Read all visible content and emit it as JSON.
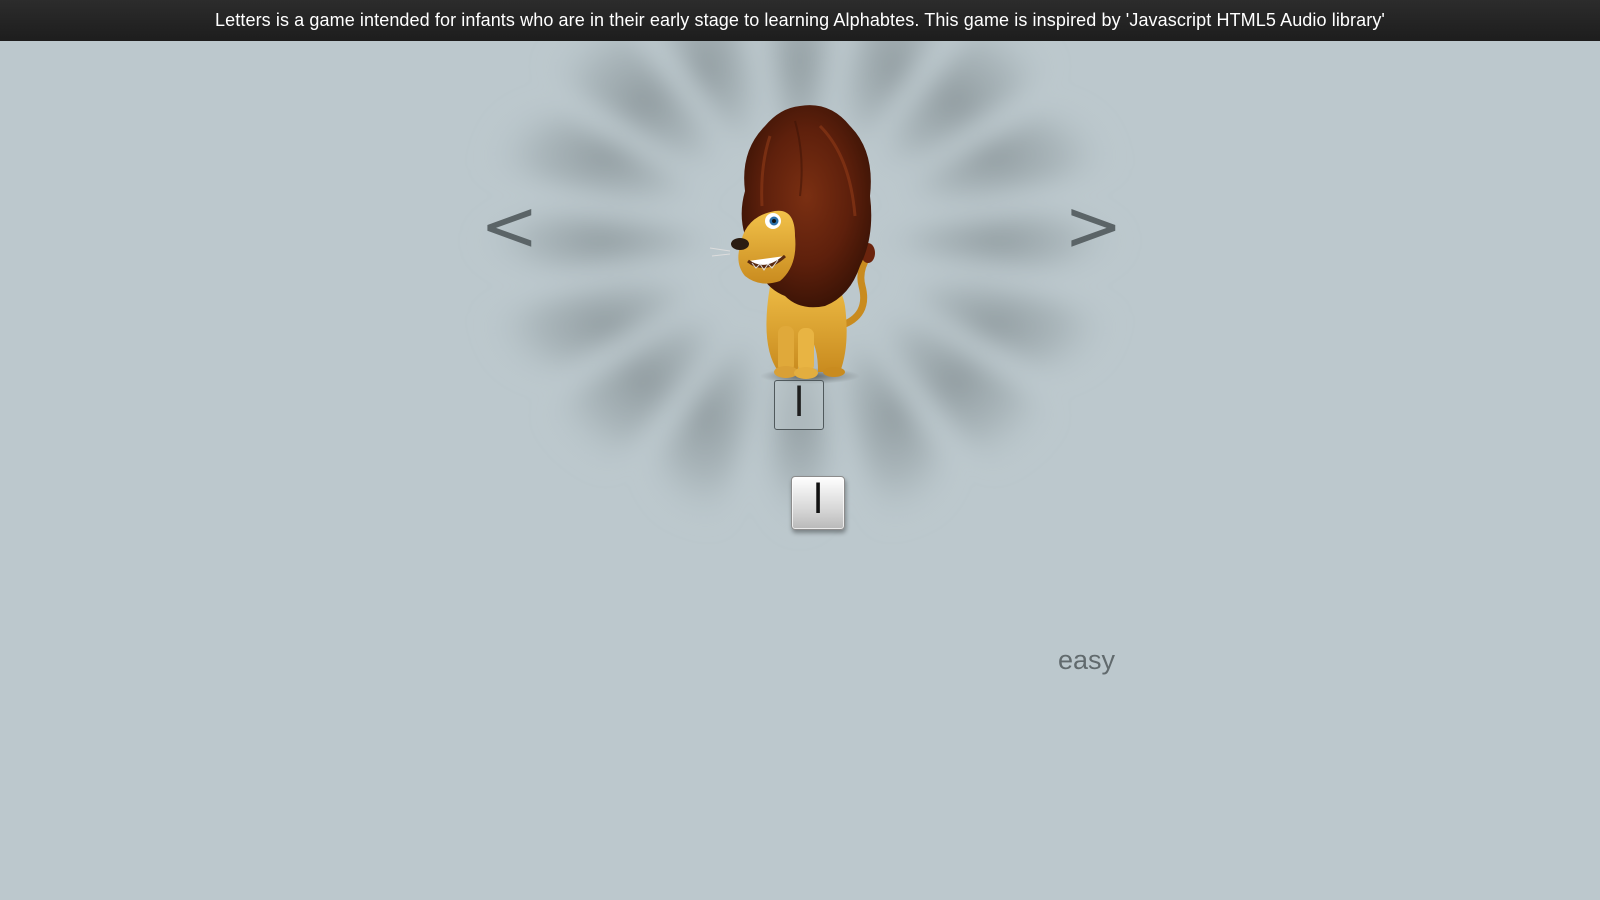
{
  "header": {
    "description": "Letters is a game intended for infants who are in their early stage to learning Alphabtes. This game is inspired by 'Javascript HTML5 Audio library'"
  },
  "navigation": {
    "prev_label": "<",
    "next_label": ">"
  },
  "game": {
    "current_animal_icon": "lion-icon",
    "target_letter": "l",
    "draggable_letter": "l",
    "difficulty": "easy"
  },
  "colors": {
    "background": "#bcc8cd",
    "header_bg": "#1d1d1d",
    "header_text": "#ffffff",
    "nav_arrow": "#5b6467",
    "difficulty_text": "#616a6d"
  }
}
